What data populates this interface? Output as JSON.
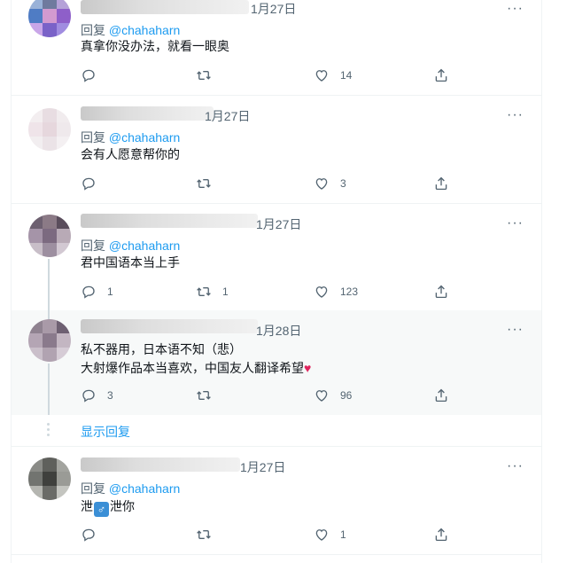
{
  "tweets": [
    {
      "time": "1月27日",
      "reply_prefix": "回复",
      "reply_handle": "@chahaharn",
      "text": "真拿你没办法，就看一眼奥",
      "reply_count": "",
      "retweet_count": "",
      "like_count": "14",
      "avatar_colors": [
        "#9ab2d8",
        "#6f7a9e",
        "#b5a2d8",
        "#4f7cc4",
        "#d39ad0",
        "#8e5fc9",
        "#c9a6e8",
        "#7a62c8",
        "#a08ce0"
      ]
    },
    {
      "time": "1月27日",
      "reply_prefix": "回复",
      "reply_handle": "@chahaharn",
      "text": "会有人愿意帮你的",
      "reply_count": "",
      "retweet_count": "",
      "like_count": "3",
      "avatar_colors": [
        "#f3eef0",
        "#e8dde2",
        "#f1ecee",
        "#efe4e9",
        "#e6d7dd",
        "#efe9ec",
        "#f2eef0",
        "#ebe3e7",
        "#f4f0f2"
      ]
    },
    {
      "time": "1月27日",
      "reply_prefix": "回复",
      "reply_handle": "@chahaharn",
      "text": "君中国语本当上手",
      "reply_count": "1",
      "retweet_count": "1",
      "like_count": "123",
      "avatar_colors": [
        "#6d6070",
        "#8b7a86",
        "#5a4d5c",
        "#a594a8",
        "#7c6a80",
        "#b8aab6",
        "#c8bec8",
        "#9d8fa0",
        "#d2c8d2"
      ]
    },
    {
      "time": "1月28日",
      "reply_prefix": "",
      "reply_handle": "",
      "text_lines": [
        "私不器用，日本语不知（悲）",
        "大射爆作品本当喜欢，中国友人翻译希望"
      ],
      "heart_emoji": "♥",
      "reply_count": "3",
      "retweet_count": "",
      "like_count": "96",
      "avatar_colors": [
        "#8f8290",
        "#a99aa8",
        "#6e6072",
        "#b4a5b4",
        "#8a7a8c",
        "#c3b6c2",
        "#cabfca",
        "#b1a3b1",
        "#d6ccd6"
      ]
    },
    {
      "time": "1月27日",
      "reply_prefix": "回复",
      "reply_handle": "@chahaharn",
      "text_before": "泄",
      "symbol": "♂",
      "text_after": "泄你",
      "reply_count": "",
      "retweet_count": "",
      "like_count": "1",
      "avatar_colors": [
        "#8a8b87",
        "#5f605c",
        "#a3a49f",
        "#727470",
        "#3f403d",
        "#9a9b96",
        "#b5b6b1",
        "#6a6b67",
        "#c4c5c0"
      ]
    }
  ],
  "show_replies_label": "显示回复",
  "more_label": "···",
  "icons": {
    "reply": "reply-icon",
    "retweet": "retweet-icon",
    "like": "heart-icon",
    "share": "share-icon",
    "more": "more-icon"
  },
  "colors": {
    "link": "#1d9bf0",
    "secondary": "#536471",
    "border": "#eff3f4",
    "highlight_bg": "#f7f9f9"
  }
}
